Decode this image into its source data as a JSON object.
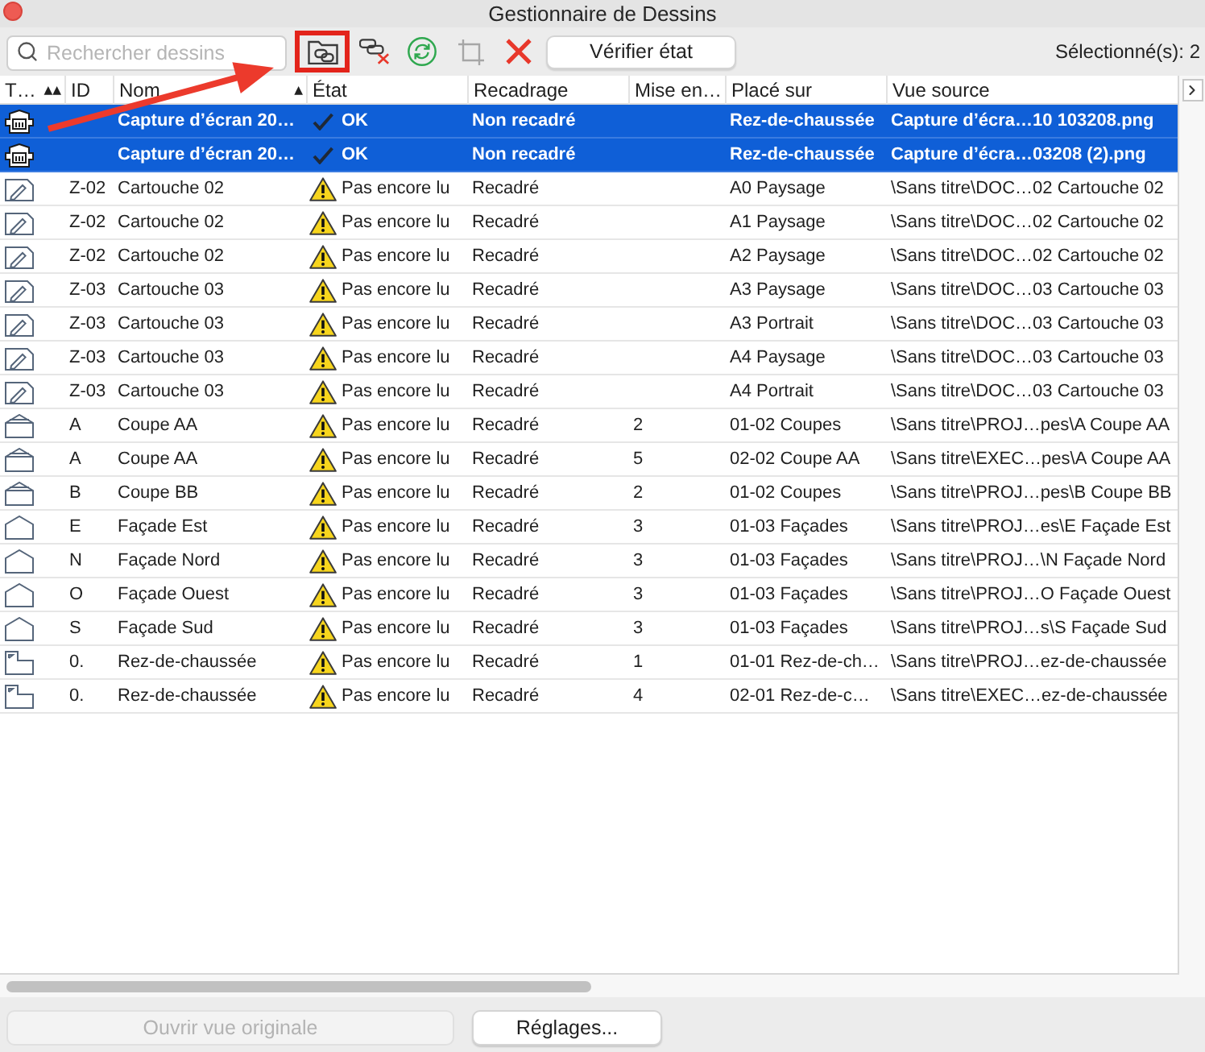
{
  "window": {
    "title": "Gestionnaire de Dessins"
  },
  "toolbar": {
    "search": {
      "placeholder": "Rechercher dessins"
    },
    "tools": [
      {
        "kind": "link_folder",
        "highlighted": true,
        "disabled": false
      },
      {
        "kind": "unlink",
        "highlighted": false,
        "disabled": false
      },
      {
        "kind": "refresh",
        "highlighted": false,
        "disabled": false
      },
      {
        "kind": "crop",
        "highlighted": false,
        "disabled": true
      },
      {
        "kind": "delete",
        "highlighted": false,
        "disabled": false
      }
    ],
    "verify_button": {
      "label": "Vérifier état"
    },
    "selection_count": "Sélectionné(s): 2"
  },
  "table": {
    "columns": [
      {
        "label": "T…",
        "sort_mark": "▲▲"
      },
      {
        "label": "ID"
      },
      {
        "label": "Nom",
        "sort_mark": "▲"
      },
      {
        "label": "État"
      },
      {
        "label": "Recadrage"
      },
      {
        "label": "Mise en…"
      },
      {
        "label": "Placé sur"
      },
      {
        "label": "Vue source"
      }
    ],
    "rows": [
      {
        "kind": "image",
        "name": "Capture d’écran 20…",
        "status": {
          "kind": "ok",
          "label": "OK"
        },
        "crop": "Non recadré",
        "placed_on": "Rez-de-chaussée",
        "source": "Capture d’écra…10 103208.png",
        "selected": true
      },
      {
        "kind": "image",
        "name": "Capture d’écran 20…",
        "status": {
          "kind": "ok",
          "label": "OK"
        },
        "crop": "Non recadré",
        "placed_on": "Rez-de-chaussée",
        "source": "Capture d’écra…03208 (2).png",
        "selected": true
      },
      {
        "kind": "title_block",
        "id": "Z-02",
        "name": "Cartouche 02",
        "status": {
          "kind": "warning",
          "label": "Pas encore lu"
        },
        "crop": "Recadré",
        "placed_on": "A0 Paysage",
        "source": "\\Sans titre\\DOC…02 Cartouche 02",
        "selected": false
      },
      {
        "kind": "title_block",
        "id": "Z-02",
        "name": "Cartouche 02",
        "status": {
          "kind": "warning",
          "label": "Pas encore lu"
        },
        "crop": "Recadré",
        "placed_on": "A1 Paysage",
        "source": "\\Sans titre\\DOC…02 Cartouche 02",
        "selected": false
      },
      {
        "kind": "title_block",
        "id": "Z-02",
        "name": "Cartouche 02",
        "status": {
          "kind": "warning",
          "label": "Pas encore lu"
        },
        "crop": "Recadré",
        "placed_on": "A2 Paysage",
        "source": "\\Sans titre\\DOC…02 Cartouche 02",
        "selected": false
      },
      {
        "kind": "title_block",
        "id": "Z-03",
        "name": "Cartouche 03",
        "status": {
          "kind": "warning",
          "label": "Pas encore lu"
        },
        "crop": "Recadré",
        "placed_on": "A3 Paysage",
        "source": "\\Sans titre\\DOC…03 Cartouche 03",
        "selected": false
      },
      {
        "kind": "title_block",
        "id": "Z-03",
        "name": "Cartouche 03",
        "status": {
          "kind": "warning",
          "label": "Pas encore lu"
        },
        "crop": "Recadré",
        "placed_on": "A3 Portrait",
        "source": "\\Sans titre\\DOC…03 Cartouche 03",
        "selected": false
      },
      {
        "kind": "title_block",
        "id": "Z-03",
        "name": "Cartouche 03",
        "status": {
          "kind": "warning",
          "label": "Pas encore lu"
        },
        "crop": "Recadré",
        "placed_on": "A4 Paysage",
        "source": "\\Sans titre\\DOC…03 Cartouche 03",
        "selected": false
      },
      {
        "kind": "title_block",
        "id": "Z-03",
        "name": "Cartouche 03",
        "status": {
          "kind": "warning",
          "label": "Pas encore lu"
        },
        "crop": "Recadré",
        "placed_on": "A4 Portrait",
        "source": "\\Sans titre\\DOC…03 Cartouche 03",
        "selected": false
      },
      {
        "kind": "section",
        "id": "A",
        "name": "Coupe AA",
        "status": {
          "kind": "warning",
          "label": "Pas encore lu"
        },
        "crop": "Recadré",
        "layout": "2",
        "placed_on": "01-02 Coupes",
        "source": "\\Sans titre\\PROJ…pes\\A Coupe AA",
        "selected": false
      },
      {
        "kind": "section",
        "id": "A",
        "name": "Coupe AA",
        "status": {
          "kind": "warning",
          "label": "Pas encore lu"
        },
        "crop": "Recadré",
        "layout": "5",
        "placed_on": "02-02 Coupe AA",
        "source": "\\Sans titre\\EXEC…pes\\A Coupe AA",
        "selected": false
      },
      {
        "kind": "section",
        "id": "B",
        "name": "Coupe BB",
        "status": {
          "kind": "warning",
          "label": "Pas encore lu"
        },
        "crop": "Recadré",
        "layout": "2",
        "placed_on": "01-02 Coupes",
        "source": "\\Sans titre\\PROJ…pes\\B Coupe BB",
        "selected": false
      },
      {
        "kind": "elevation",
        "id": "E",
        "name": "Façade Est",
        "status": {
          "kind": "warning",
          "label": "Pas encore lu"
        },
        "crop": "Recadré",
        "layout": "3",
        "placed_on": "01-03 Façades",
        "source": "\\Sans titre\\PROJ…es\\E Façade Est",
        "selected": false
      },
      {
        "kind": "elevation",
        "id": "N",
        "name": "Façade Nord",
        "status": {
          "kind": "warning",
          "label": "Pas encore lu"
        },
        "crop": "Recadré",
        "layout": "3",
        "placed_on": "01-03 Façades",
        "source": "\\Sans titre\\PROJ…\\N Façade Nord",
        "selected": false
      },
      {
        "kind": "elevation",
        "id": "O",
        "name": "Façade Ouest",
        "status": {
          "kind": "warning",
          "label": "Pas encore lu"
        },
        "crop": "Recadré",
        "layout": "3",
        "placed_on": "01-03 Façades",
        "source": "\\Sans titre\\PROJ…O Façade Ouest",
        "selected": false
      },
      {
        "kind": "elevation",
        "id": "S",
        "name": "Façade Sud",
        "status": {
          "kind": "warning",
          "label": "Pas encore lu"
        },
        "crop": "Recadré",
        "layout": "3",
        "placed_on": "01-03 Façades",
        "source": "\\Sans titre\\PROJ…s\\S Façade Sud",
        "selected": false
      },
      {
        "kind": "plan",
        "id": "0.",
        "name": "Rez-de-chaussée",
        "status": {
          "kind": "warning",
          "label": "Pas encore lu"
        },
        "crop": "Recadré",
        "layout": "1",
        "placed_on": "01-01 Rez-de-ch…",
        "source": "\\Sans titre\\PROJ…ez-de-chaussée",
        "selected": false
      },
      {
        "kind": "plan",
        "id": "0.",
        "name": "Rez-de-chaussée",
        "status": {
          "kind": "warning",
          "label": "Pas encore lu"
        },
        "crop": "Recadré",
        "layout": "4",
        "placed_on": "02-01 Rez-de-c…",
        "source": "\\Sans titre\\EXEC…ez-de-chaussée",
        "selected": false
      }
    ]
  },
  "buttons": [
    {
      "label": "Ouvrir vue originale",
      "disabled": true
    },
    {
      "label": "Réglages...",
      "disabled": false
    }
  ],
  "annotations": [
    {
      "kind": "arrow"
    }
  ]
}
